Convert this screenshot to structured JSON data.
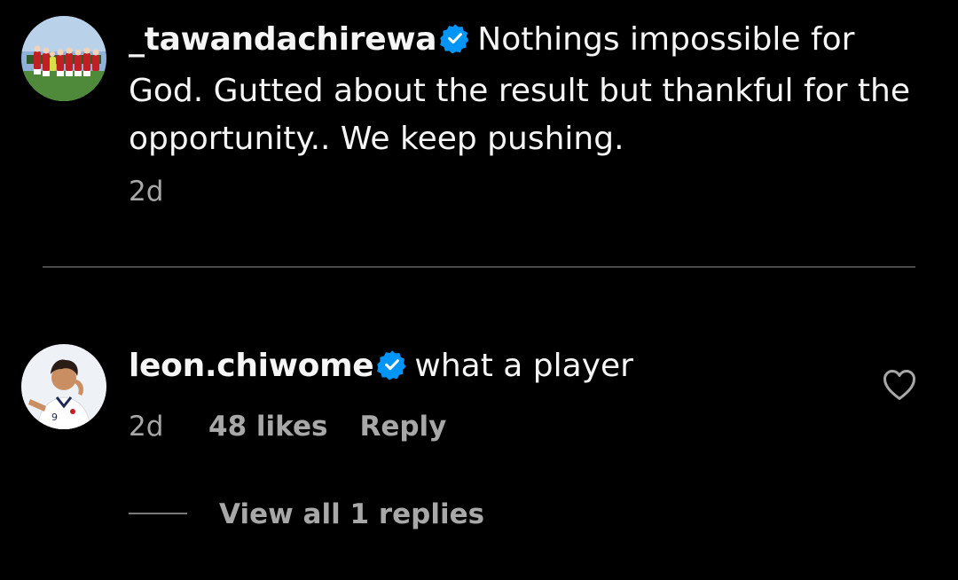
{
  "post": {
    "username": "_tawandachirewa",
    "verified_icon": "verified-badge-icon",
    "line1": "Nothings impossible for",
    "line2": "God. Gutted about the result but thankful for the",
    "line3": "opportunity.. We keep pushing.",
    "time": "2d"
  },
  "comment": {
    "username": "leon.chiwome",
    "verified_icon": "verified-badge-icon",
    "text": "what a player",
    "time": "2d",
    "likes": "48 likes",
    "reply_label": "Reply",
    "like_icon": "heart-outline-icon"
  },
  "replies": {
    "view_label": "View all 1 replies"
  },
  "colors": {
    "background": "#000000",
    "text": "#f5f5f5",
    "muted": "#a8a8a8",
    "verified": "#0095f6",
    "divider": "#4a4a4a"
  }
}
